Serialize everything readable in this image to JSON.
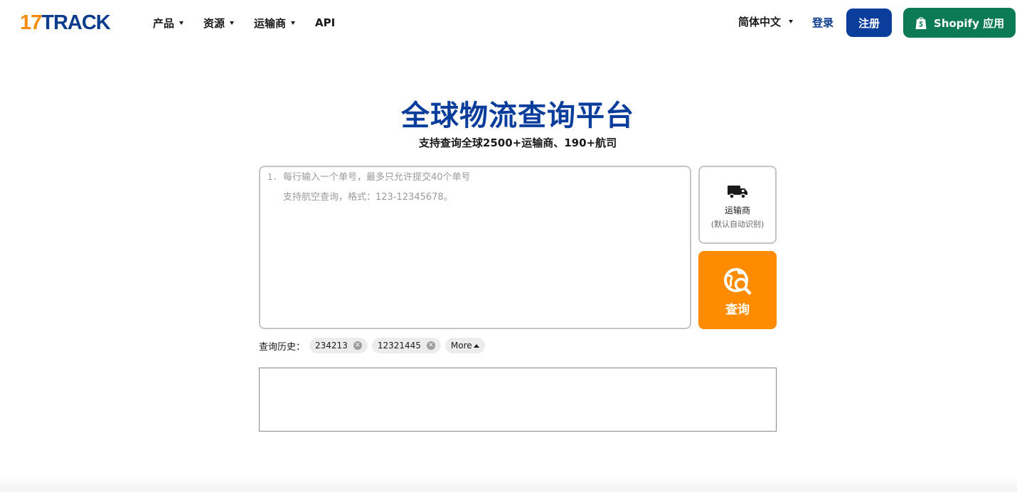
{
  "header": {
    "logo_number": "17",
    "logo_word": "TRACK",
    "nav": [
      {
        "label": "产品",
        "has_dropdown": true
      },
      {
        "label": "资源",
        "has_dropdown": true
      },
      {
        "label": "运输商",
        "has_dropdown": true
      },
      {
        "label": "API",
        "has_dropdown": false
      }
    ],
    "language": "简体中文",
    "login": "登录",
    "register": "注册",
    "shopify": "Shopify 应用"
  },
  "hero": {
    "title": "全球物流查询平台",
    "subtitle": "支持查询全球2500+运输商、190+航司"
  },
  "tracking": {
    "line_number": "1.",
    "placeholder_line1": "每行输入一个单号，最多只允许提交40个单号",
    "placeholder_line2": "支持航空查询，格式：123-12345678。",
    "carrier_label": "运输商",
    "carrier_sub": "(默认自动识别)",
    "search_label": "查询"
  },
  "history": {
    "label": "查询历史：",
    "items": [
      {
        "value": "234213"
      },
      {
        "value": "12321445"
      }
    ],
    "more_label": "More"
  },
  "colors": {
    "brand_blue": "#0a3d9c",
    "logo_orange": "#f58a07",
    "search_orange": "#ff8c00",
    "shopify_green": "#0b7a55"
  }
}
